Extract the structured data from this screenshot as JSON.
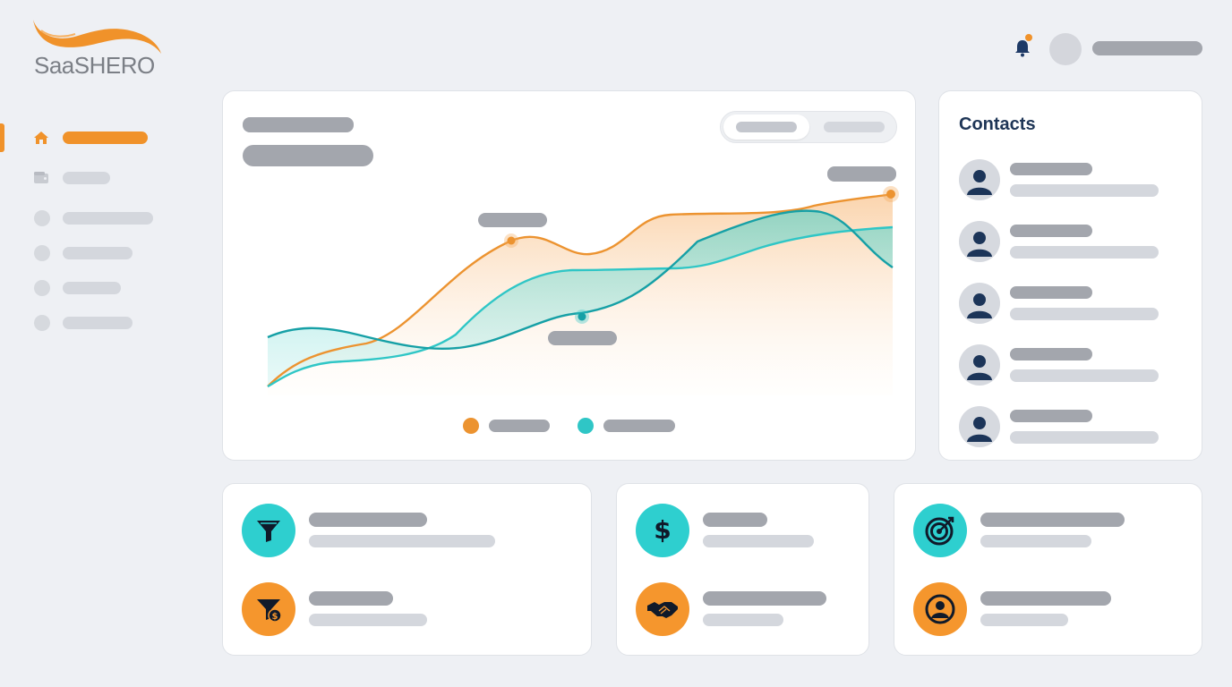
{
  "brand": {
    "name_part1": "Saa",
    "name_part2": "SHERO",
    "accent": "#f0922a",
    "teal": "#2bc4c4",
    "navy": "#1e3556"
  },
  "sidebar": {
    "items": [
      {
        "icon": "home-icon",
        "active": true
      },
      {
        "icon": "wallet-icon",
        "active": false
      },
      {
        "icon": "circle-icon",
        "active": false
      },
      {
        "icon": "circle-icon",
        "active": false
      },
      {
        "icon": "circle-icon",
        "active": false
      },
      {
        "icon": "circle-icon",
        "active": false
      }
    ]
  },
  "header": {
    "notification_icon": "bell-icon",
    "has_notification": true
  },
  "chart_data": {
    "type": "area",
    "series": [
      {
        "color": "#f0922a",
        "points": [
          [
            0,
            0.05
          ],
          [
            0.1,
            0.22
          ],
          [
            0.18,
            0.3
          ],
          [
            0.3,
            0.62
          ],
          [
            0.39,
            0.72
          ],
          [
            0.5,
            0.68
          ],
          [
            0.62,
            0.86
          ],
          [
            0.78,
            0.88
          ],
          [
            1,
            1.0
          ]
        ]
      },
      {
        "color": "#2bc4c4",
        "points": [
          [
            0,
            0.0
          ],
          [
            0.1,
            0.12
          ],
          [
            0.25,
            0.2
          ],
          [
            0.35,
            0.5
          ],
          [
            0.5,
            0.6
          ],
          [
            0.7,
            0.64
          ],
          [
            0.85,
            0.78
          ],
          [
            1,
            0.83
          ]
        ]
      },
      {
        "color": "#1aa3a8",
        "points": [
          [
            0,
            0.28
          ],
          [
            0.08,
            0.32
          ],
          [
            0.3,
            0.22
          ],
          [
            0.5,
            0.4
          ],
          [
            0.7,
            0.7
          ],
          [
            0.88,
            0.86
          ],
          [
            1,
            0.6
          ]
        ]
      }
    ]
  },
  "contacts": {
    "title": "Contacts",
    "items": [
      {
        "avatar_icon": "user-icon"
      },
      {
        "avatar_icon": "user-icon"
      },
      {
        "avatar_icon": "user-icon"
      },
      {
        "avatar_icon": "user-icon"
      },
      {
        "avatar_icon": "user-icon"
      }
    ]
  },
  "stats": [
    {
      "icon": "funnel-icon",
      "color": "teal"
    },
    {
      "icon": "funnel-dollar-icon",
      "color": "orange"
    },
    {
      "icon": "dollar-icon",
      "color": "teal"
    },
    {
      "icon": "handshake-icon",
      "color": "orange"
    },
    {
      "icon": "target-icon",
      "color": "teal"
    },
    {
      "icon": "user-circle-icon",
      "color": "orange"
    }
  ]
}
